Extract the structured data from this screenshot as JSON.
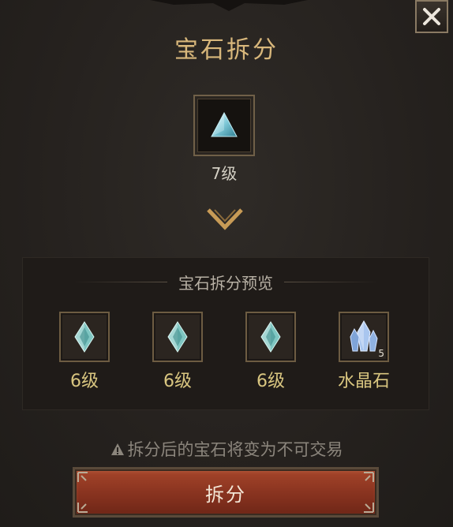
{
  "dialog": {
    "title": "宝石拆分",
    "close_icon": "close-icon"
  },
  "source_gem": {
    "icon": "triangle-gem-icon",
    "level_label": "7级"
  },
  "arrow_icon": "chevron-down-icon",
  "preview": {
    "header": "宝石拆分预览",
    "items": [
      {
        "icon": "diamond-gem-icon",
        "label": "6级",
        "count": ""
      },
      {
        "icon": "diamond-gem-icon",
        "label": "6级",
        "count": ""
      },
      {
        "icon": "diamond-gem-icon",
        "label": "6级",
        "count": ""
      },
      {
        "icon": "crystal-icon",
        "label": "水晶石",
        "count": "5"
      }
    ]
  },
  "warning": {
    "icon": "warning-icon",
    "text": "拆分后的宝石将变为不可交易"
  },
  "split_button": {
    "label": "拆分"
  },
  "colors": {
    "title": "#d8b77b",
    "item_label": "#d9c680",
    "button": "#8a3420"
  }
}
